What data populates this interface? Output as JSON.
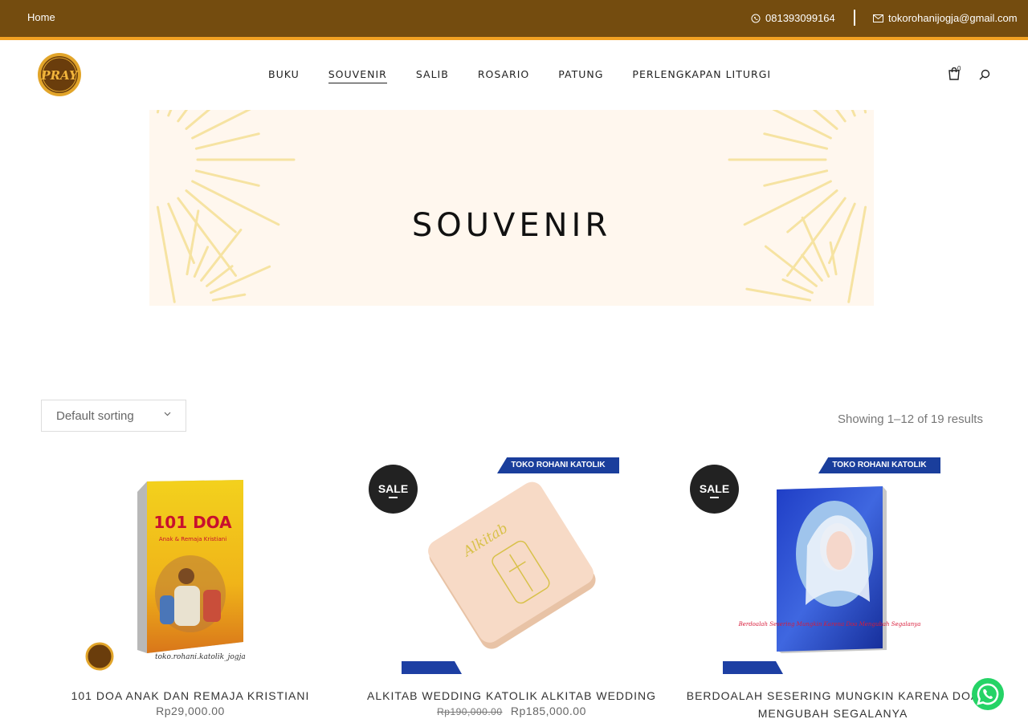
{
  "topbar": {
    "home": "Home",
    "phone": "081393099164",
    "email": "tokorohanijogja@gmail.com"
  },
  "logo": {
    "text": "PRAY"
  },
  "nav": {
    "items": [
      {
        "label": "BUKU"
      },
      {
        "label": "SOUVENIR"
      },
      {
        "label": "SALIB"
      },
      {
        "label": "ROSARIO"
      },
      {
        "label": "PATUNG"
      },
      {
        "label": "PERLENGKAPAN LITURGI"
      }
    ],
    "active": "SOUVENIR",
    "cart_count": "0"
  },
  "banner": {
    "title": "SOUVENIR"
  },
  "shop": {
    "sort_label": "Default sorting",
    "results_text": "Showing 1–12 of 19 results"
  },
  "products": [
    {
      "title": "101 DOA ANAK DAN REMAJA KRISTIANI",
      "price": "Rp29,000.00",
      "old_price": "",
      "sale": "",
      "cover_title": "101 DOA",
      "cover_subtitle": "Anak & Remaja Kristiani",
      "watermark": "toko.rohani.katolik_jogja"
    },
    {
      "title": "ALKITAB WEDDING KATOLIK ALKITAB WEDDING",
      "old_price": "Rp190,000.00",
      "price": "Rp185,000.00",
      "sale": "SALE",
      "ribbon": "TOKO ROHANI KATOLIK",
      "cover_title": "Alkitab"
    },
    {
      "title": "BERDOALAH SESERING MUNGKIN KARENA DOA MENGUBAH SEGALANYA",
      "old_price": "",
      "price": "",
      "sale": "SALE",
      "ribbon": "TOKO ROHANI KATOLIK",
      "cover_text": "Berdoalah Sesering Mungkin Karena Doa Mengubah Segalanya"
    }
  ],
  "colors": {
    "topbar": "#744c0f",
    "topbar_strip": "#f2a122",
    "banner_bg": "#fff7ee",
    "ribbon": "#1a3e9c",
    "whatsapp": "#25d366"
  }
}
